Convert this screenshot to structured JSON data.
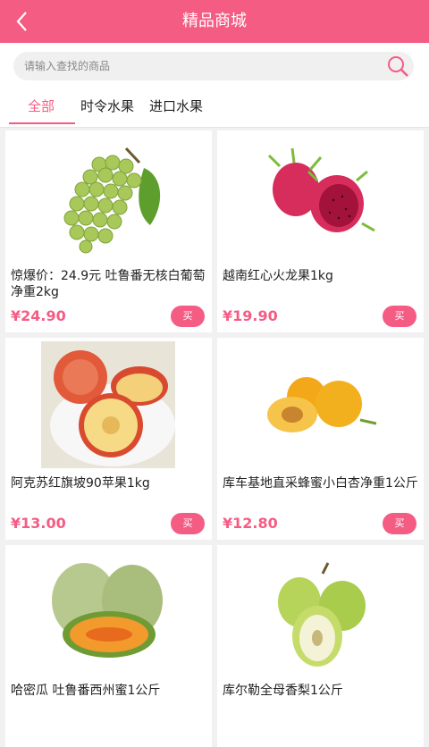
{
  "header": {
    "title": "精品商城"
  },
  "search": {
    "placeholder": "请输入查找的商品"
  },
  "tabs": [
    {
      "label": "全部"
    },
    {
      "label": "时令水果"
    },
    {
      "label": "进口水果"
    }
  ],
  "products": [
    {
      "name": "惊爆价：24.9元 吐鲁番无核白葡萄净重2kg",
      "price": "¥24.90",
      "buy_label": "买",
      "image": "green-grapes"
    },
    {
      "name": "越南红心火龙果1kg",
      "price": "¥19.90",
      "buy_label": "买",
      "image": "red-dragon-fruit"
    },
    {
      "name": "阿克苏红旗坡90苹果1kg",
      "price": "¥13.00",
      "buy_label": "买",
      "image": "apples"
    },
    {
      "name": "库车基地直采蜂蜜小白杏净重1公斤",
      "price": "¥12.80",
      "buy_label": "买",
      "image": "apricots"
    },
    {
      "name": "哈密瓜 吐鲁番西州蜜1公斤",
      "price": "",
      "buy_label": "",
      "image": "hami-melon"
    },
    {
      "name": "库尔勒全母香梨1公斤",
      "price": "",
      "buy_label": "",
      "image": "pears"
    }
  ],
  "colors": {
    "accent": "#f55c84"
  }
}
